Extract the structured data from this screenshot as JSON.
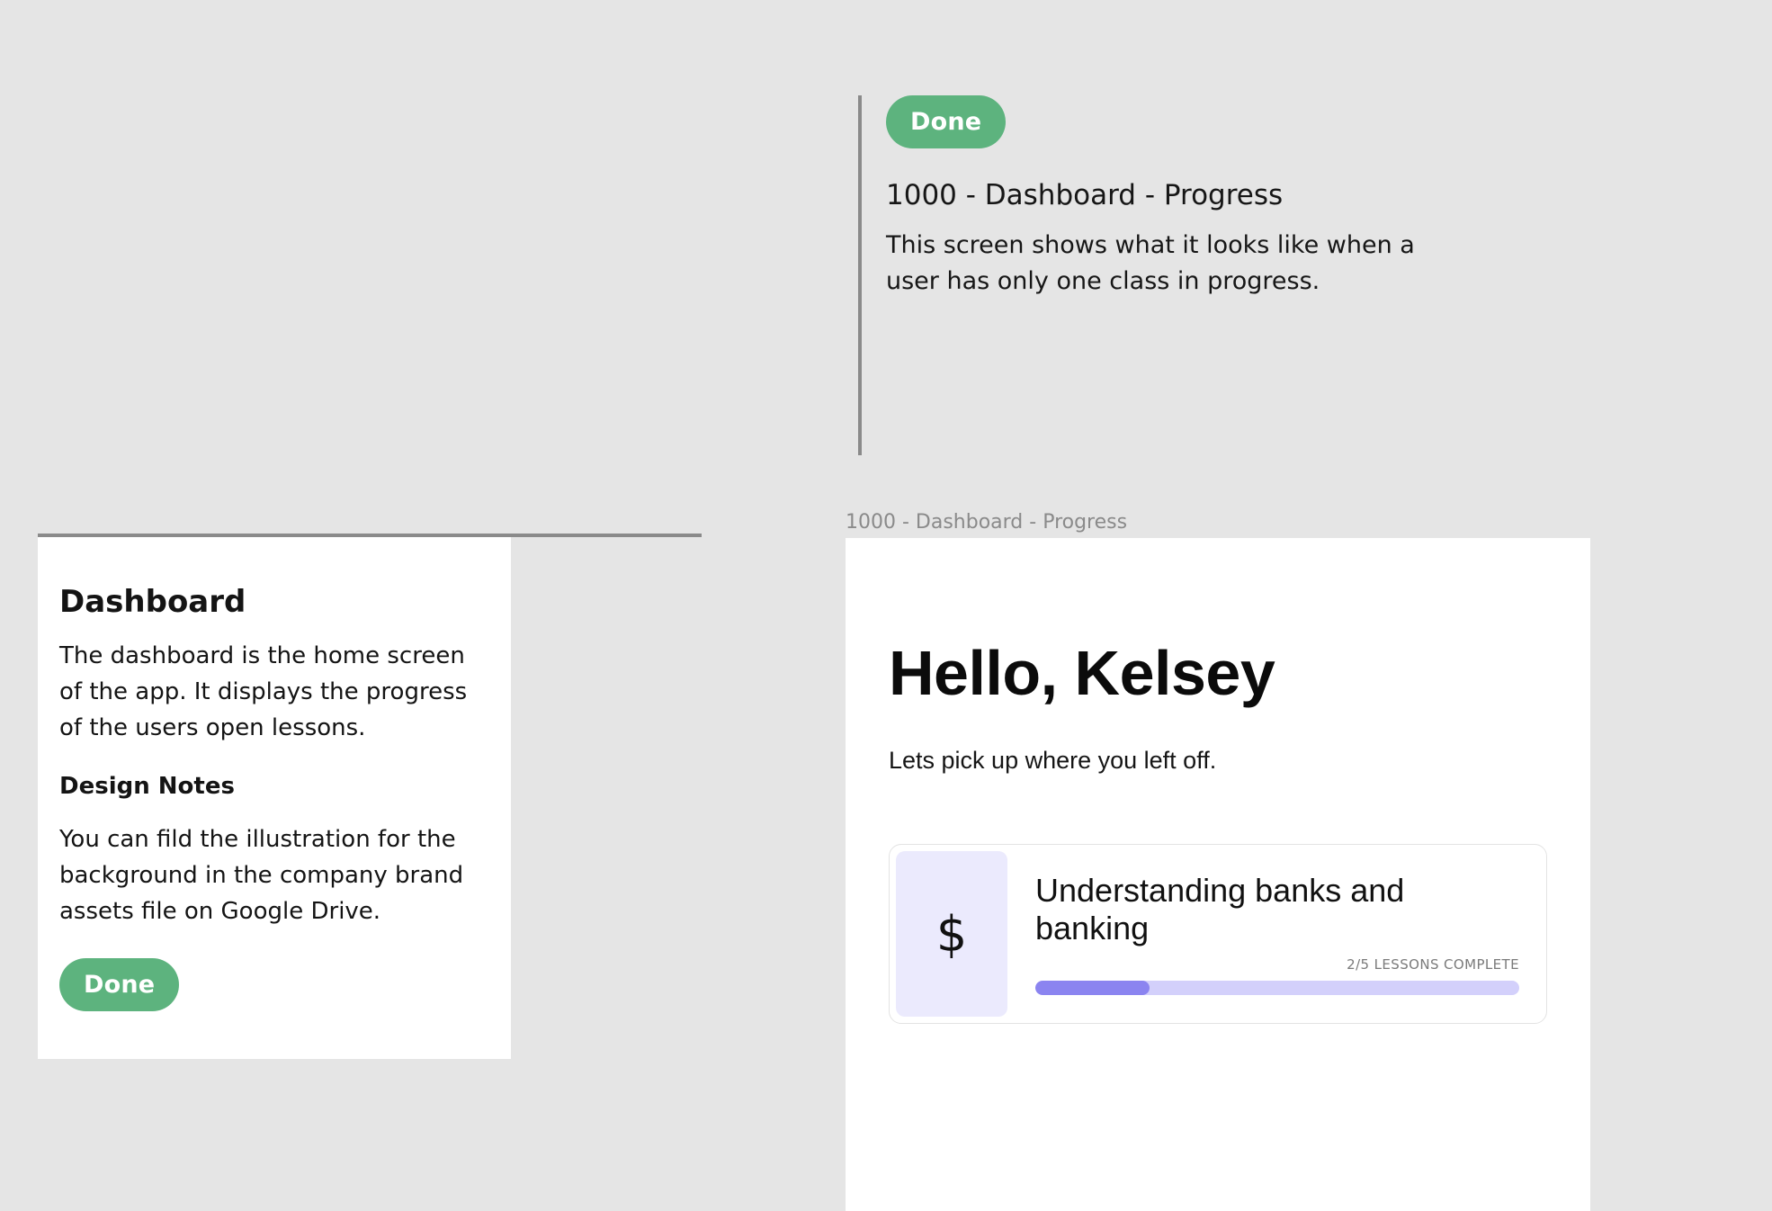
{
  "colors": {
    "background": "#e5e5e5",
    "done_pill": "#5db37e",
    "annotation_rule": "#8a8a8a",
    "progress_track": "#d3d0fb",
    "progress_fill": "#8b84f0",
    "course_thumb": "#ebeafd"
  },
  "annotation_top": {
    "status": "Done",
    "title": "1000 - Dashboard - Progress",
    "description": "This screen shows what it looks like when a user has only one class in progress."
  },
  "note_card": {
    "heading": "Dashboard",
    "body": "The dashboard is the home screen of the app. It displays the progress of the users open lessons.",
    "subheading": "Design Notes",
    "body2": "You can fild the illustration for the background in the company brand assets file on Google Drive.",
    "status": "Done"
  },
  "artboard": {
    "label": "1000 - Dashboard - Progress",
    "greeting": "Hello, Kelsey",
    "subtitle": "Lets pick up where you left off.",
    "course": {
      "icon": "dollar-icon",
      "icon_glyph": "$",
      "title": "Understanding banks and banking",
      "progress_label": "2/5 LESSONS COMPLETE",
      "lessons_completed": 2,
      "lessons_total": 5
    }
  }
}
